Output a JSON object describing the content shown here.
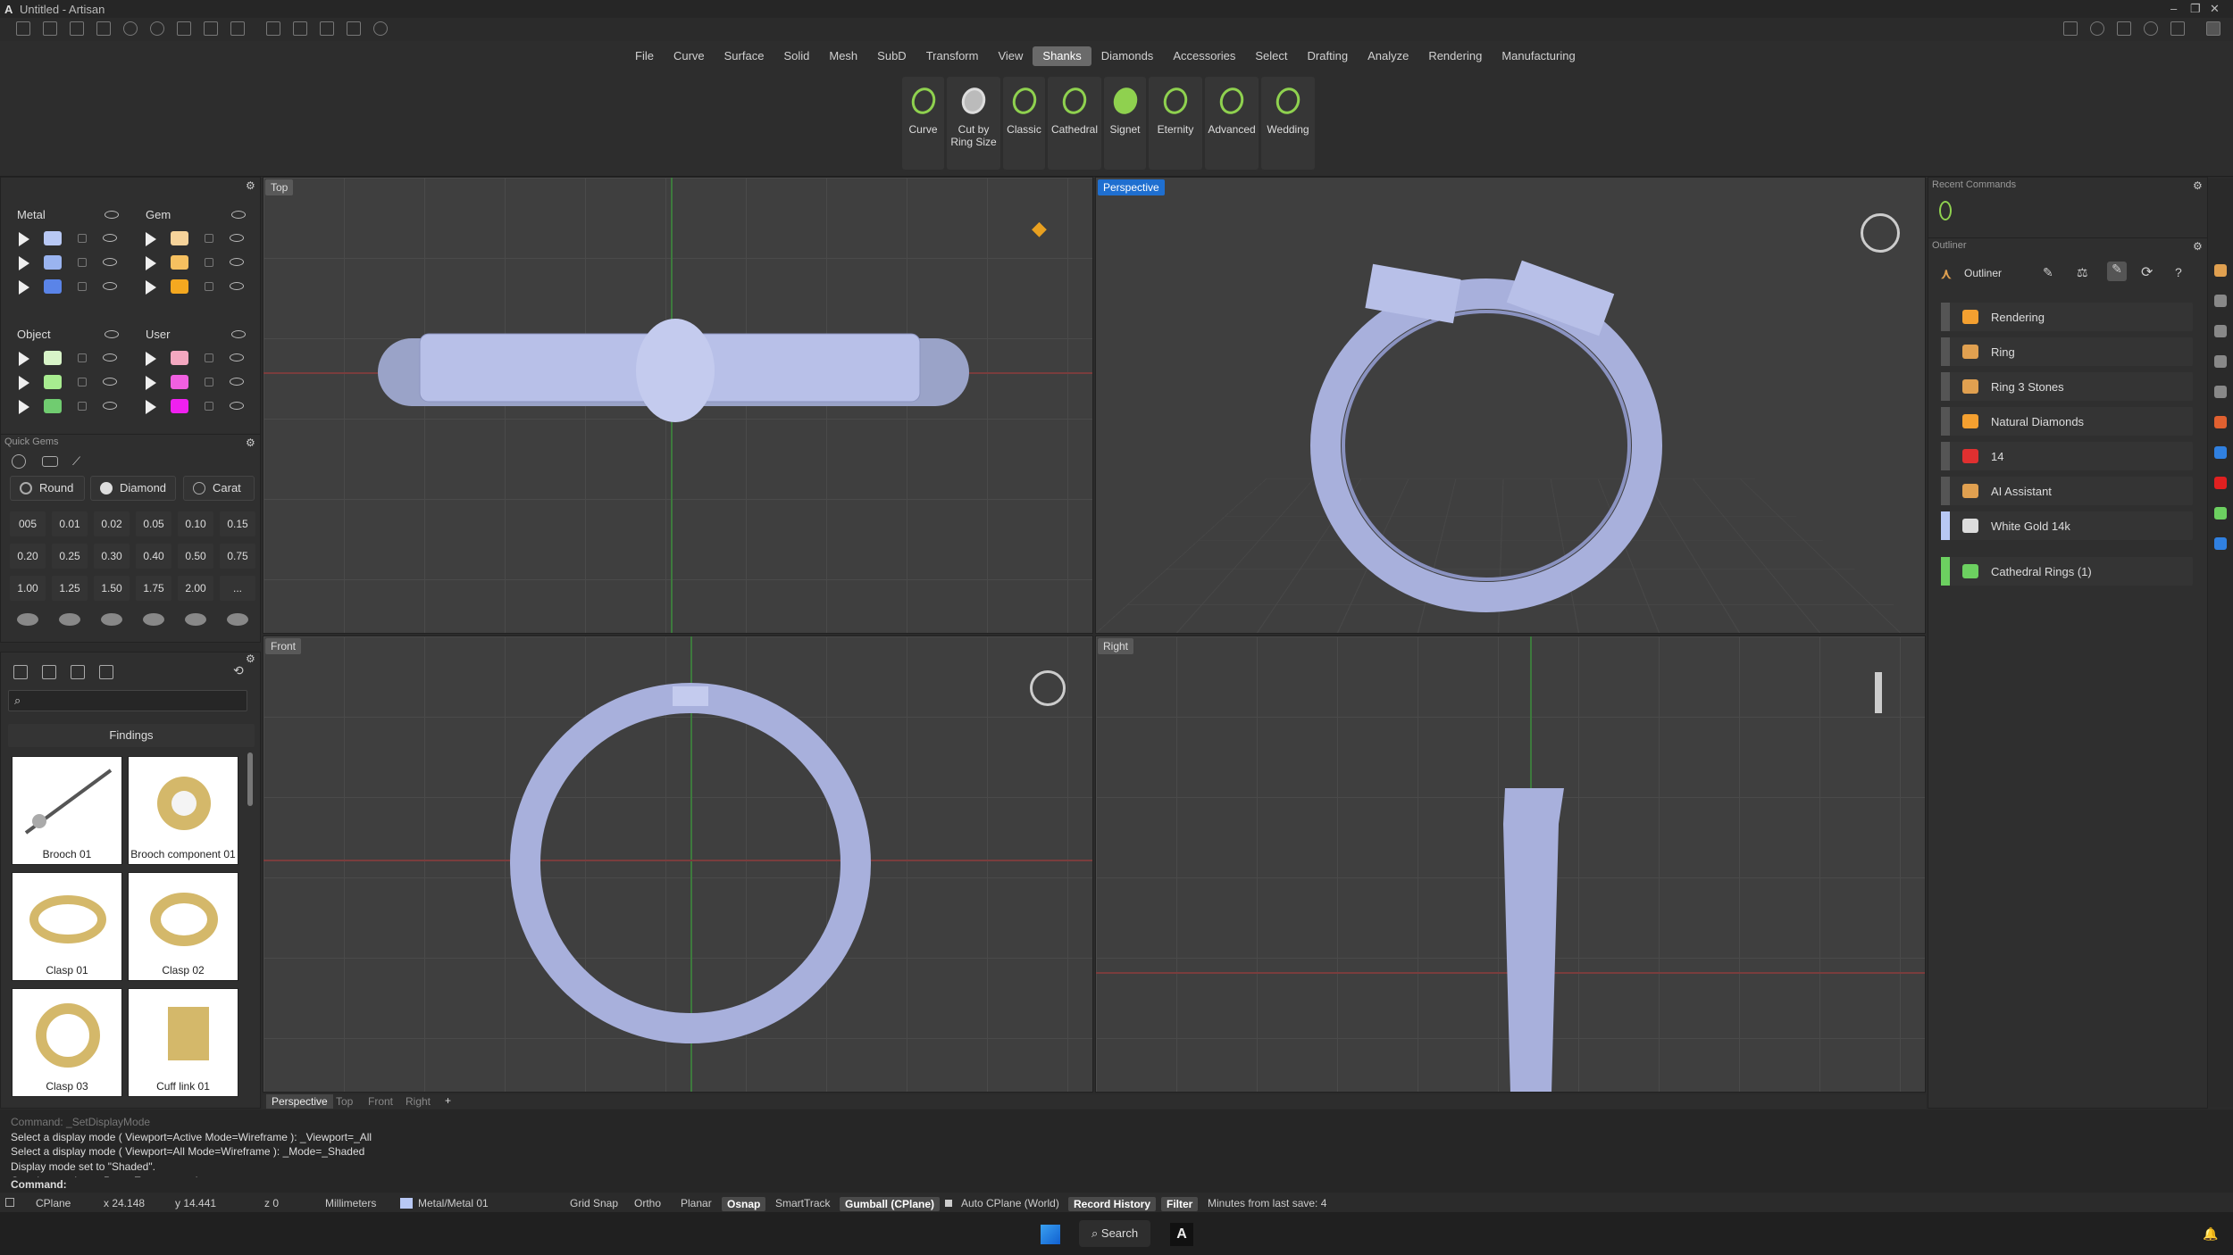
{
  "window": {
    "title": "Untitled - Artisan"
  },
  "menu": {
    "items": [
      "File",
      "Curve",
      "Surface",
      "Solid",
      "Mesh",
      "SubD",
      "Transform",
      "View",
      "Shanks",
      "Diamonds",
      "Accessories",
      "Select",
      "Drafting",
      "Analyze",
      "Rendering",
      "Manufacturing"
    ],
    "active": "Shanks"
  },
  "shank_tools": [
    "Curve",
    "Cut by Ring Size",
    "Classic",
    "Cathedral",
    "Signet",
    "Eternity",
    "Advanced",
    "Wedding"
  ],
  "layers": {
    "metal": {
      "label": "Metal",
      "colors": [
        "#b8c8f4",
        "#9ab4f0",
        "#5a84e8"
      ]
    },
    "gem": {
      "label": "Gem",
      "colors": [
        "#f6d39a",
        "#f6c060",
        "#f4a820"
      ]
    },
    "object": {
      "label": "Object",
      "colors": [
        "#d8f4c8",
        "#a8ec90",
        "#70cc70"
      ]
    },
    "user": {
      "label": "User",
      "colors": [
        "#f4a8c0",
        "#f060e0",
        "#f020f0"
      ]
    }
  },
  "quick_gems": {
    "title": "Quick Gems",
    "shape": "Round",
    "material": "Diamond",
    "unit": "Carat",
    "sizes": [
      "005",
      "0.01",
      "0.02",
      "0.05",
      "0.10",
      "0.15",
      "0.20",
      "0.25",
      "0.30",
      "0.40",
      "0.50",
      "0.75",
      "1.00",
      "1.25",
      "1.50",
      "1.75",
      "2.00",
      "..."
    ]
  },
  "library": {
    "category": "Findings",
    "items": [
      "Brooch 01",
      "Brooch component 01",
      "Clasp 01",
      "Clasp 02",
      "Clasp 03",
      "Cuff link 01"
    ]
  },
  "viewports": {
    "top": "Top",
    "perspective": "Perspective",
    "front": "Front",
    "right": "Right"
  },
  "viewport_tabs": [
    "Perspective",
    "Top",
    "Front",
    "Right",
    "+"
  ],
  "recent_commands": {
    "title": "Recent Commands"
  },
  "outliner": {
    "section": "Outliner",
    "title": "Outliner",
    "items": [
      {
        "label": "Rendering",
        "color": "#f4a030"
      },
      {
        "label": "Ring",
        "color": "#e0a050"
      },
      {
        "label": "Ring 3 Stones",
        "color": "#e0a050"
      },
      {
        "label": "Natural Diamonds",
        "color": "#f4a030"
      },
      {
        "label": "14",
        "color": "#e03030"
      },
      {
        "label": "AI Assistant",
        "color": "#e0a050"
      },
      {
        "label": "White Gold 14k",
        "color": "#dddddd"
      },
      {
        "label": "Cathedral Rings (1)",
        "color": "#6cd060"
      }
    ]
  },
  "command_history": [
    "Command: _SetDisplayMode",
    "Select a display mode ( Viewport=Active  Mode=Wireframe ): _Viewport=_All",
    "Select a display mode ( Viewport=All  Mode=Wireframe ): _Mode=_Shaded",
    "Display mode set to \"Shaded\".",
    "Creating meshes... Press Esc to cancel"
  ],
  "command_prompt": "Command:",
  "status": {
    "cplane": "CPlane",
    "x": "x 24.148",
    "y": "y 14.441",
    "z": "z 0",
    "units": "Millimeters",
    "layer": "Metal/Metal 01",
    "grid_snap": "Grid Snap",
    "ortho": "Ortho",
    "planar": "Planar",
    "osnap": "Osnap",
    "smarttrack": "SmartTrack",
    "gumball": "Gumball (CPlane)",
    "auto_cplane": "Auto CPlane (World)",
    "record_history": "Record History",
    "filter": "Filter",
    "last_save": "Minutes from last save: 4"
  },
  "taskbar": {
    "search": "Search"
  }
}
